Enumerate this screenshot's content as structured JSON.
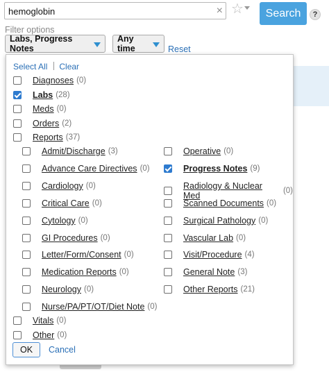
{
  "search": {
    "value": "hemoglobin",
    "submit_label": "Search",
    "clear_icon": "×",
    "help_label": "?"
  },
  "favorite_icon": "☆",
  "filter": {
    "label": "Filter options",
    "type_pill": "Labs, Progress Notes",
    "time_pill": "Any time",
    "reset": "Reset"
  },
  "panel": {
    "select_all": "Select All",
    "clear": "Clear",
    "top_items": [
      {
        "label": "Diagnoses",
        "count": "(0)",
        "checked": false
      },
      {
        "label": "Labs",
        "count": "(28)",
        "checked": true
      },
      {
        "label": "Meds",
        "count": "(0)",
        "checked": false
      },
      {
        "label": "Orders",
        "count": "(2)",
        "checked": false
      },
      {
        "label": "Reports",
        "count": "(37)",
        "checked": false
      }
    ],
    "reports_left": [
      {
        "label": "Admit/Discharge",
        "count": "(3)",
        "checked": false
      },
      {
        "label": "Advance Care Directives",
        "count": "(0)",
        "checked": false
      },
      {
        "label": "Cardiology",
        "count": "(0)",
        "checked": false
      },
      {
        "label": "Critical Care",
        "count": "(0)",
        "checked": false
      },
      {
        "label": "Cytology",
        "count": "(0)",
        "checked": false
      },
      {
        "label": "GI Procedures",
        "count": "(0)",
        "checked": false
      },
      {
        "label": "Letter/Form/Consent",
        "count": "(0)",
        "checked": false
      },
      {
        "label": "Medication Reports",
        "count": "(0)",
        "checked": false
      },
      {
        "label": "Neurology",
        "count": "(0)",
        "checked": false
      },
      {
        "label": "Nurse/PA/PT/OT/Diet Note",
        "count": "(0)",
        "checked": false
      }
    ],
    "reports_right": [
      {
        "label": "Operative",
        "count": "(0)",
        "checked": false
      },
      {
        "label": "Progress Notes",
        "count": "(9)",
        "checked": true
      },
      {
        "label": "Radiology & Nuclear Med",
        "count": "(0)",
        "checked": false
      },
      {
        "label": "Scanned Documents",
        "count": "(0)",
        "checked": false
      },
      {
        "label": "Surgical Pathology",
        "count": "(0)",
        "checked": false
      },
      {
        "label": "Vascular Lab",
        "count": "(0)",
        "checked": false
      },
      {
        "label": "Visit/Procedure",
        "count": "(4)",
        "checked": false
      },
      {
        "label": "General Note",
        "count": "(3)",
        "checked": false
      },
      {
        "label": "Other Reports",
        "count": "(21)",
        "checked": false
      }
    ],
    "bottom_items": [
      {
        "label": "Vitals",
        "count": "(0)",
        "checked": false
      },
      {
        "label": "Other",
        "count": "(0)",
        "checked": false
      }
    ],
    "ok": "OK",
    "cancel": "Cancel"
  }
}
